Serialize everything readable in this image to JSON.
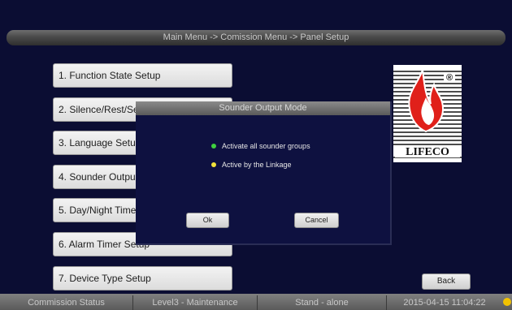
{
  "breadcrumb": "Main Menu -> Comission Menu -> Panel Setup",
  "menu": {
    "items": [
      "1. Function State Setup",
      "2. Silence/Rest/Setup",
      "3. Language Setup",
      "4. Sounder Output Mode",
      "5. Day/Night Timer Setup",
      "6. Alarm Timer Setup",
      "7. Device Type Setup"
    ]
  },
  "logo": {
    "brand_text": "LIFECO",
    "registered_mark": "®"
  },
  "dialog": {
    "title": "Sounder Output Mode",
    "options": [
      {
        "label": "Activate all sounder groups",
        "color": "#3fd13f"
      },
      {
        "label": "Active by the Linkage",
        "color": "#f2e33a"
      }
    ],
    "ok_label": "Ok",
    "cancel_label": "Cancel"
  },
  "back_label": "Back",
  "status": {
    "commission": "Commission Status",
    "level": "Level3 - Maintenance",
    "mode": "Stand - alone",
    "datetime": "2015-04-15 11:04:22",
    "indicator_color": "#f2c200"
  }
}
